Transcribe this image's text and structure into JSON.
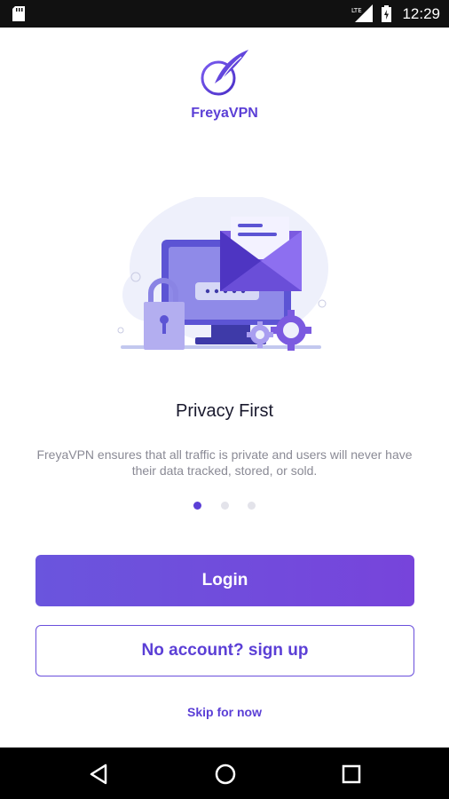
{
  "status_bar": {
    "time": "12:29",
    "icons": [
      "sd-card-icon",
      "lte-signal-icon",
      "battery-icon"
    ]
  },
  "header": {
    "brand": "FreyaVPN",
    "logo_icon": "feather-logo-icon"
  },
  "onboarding": {
    "title": "Privacy First",
    "description": "FreyaVPN ensures that all traffic is private and users will never have  their data tracked, stored, or sold.",
    "current_page": 1,
    "page_count": 3
  },
  "actions": {
    "login_label": "Login",
    "signup_label": "No account? sign up",
    "skip_label": "Skip for now"
  },
  "colors": {
    "accent": "#5b3fd6",
    "accent_gradient_end": "#7744db",
    "status_bar": "#111111",
    "nav_bar": "#000000"
  },
  "nav_bar": {
    "icons": [
      "back-icon",
      "home-icon",
      "recents-icon"
    ]
  }
}
